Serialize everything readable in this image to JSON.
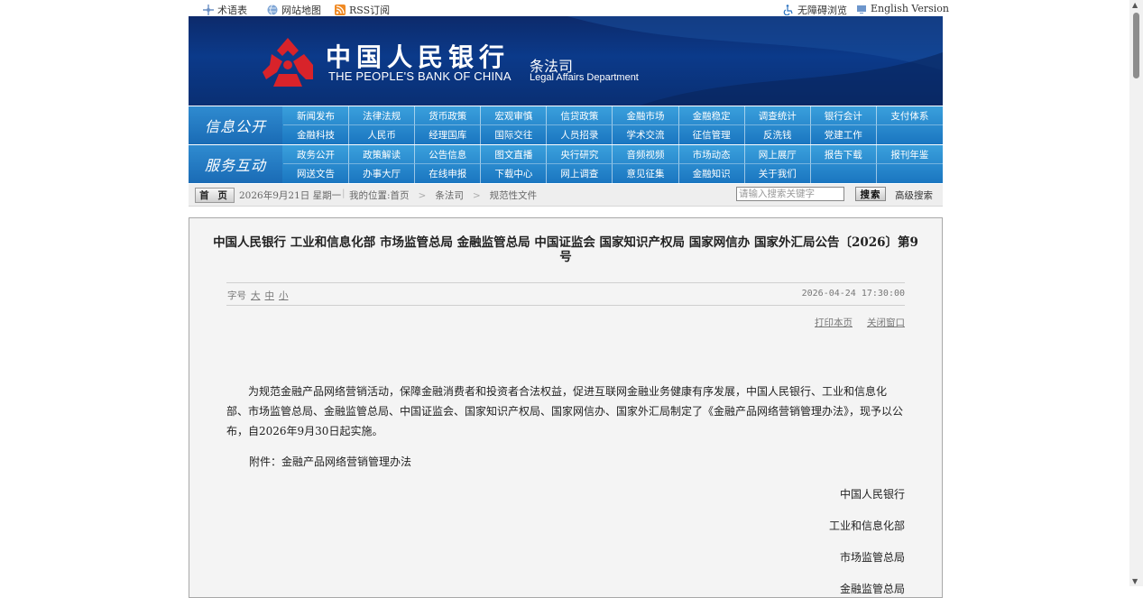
{
  "topbar": {
    "glossary": "术语表",
    "sitemap": "网站地图",
    "rss": "RSS订阅",
    "accessibility": "无障碍浏览",
    "english": "English Version"
  },
  "banner": {
    "cn_name": "中国人民银行",
    "en_name": "THE PEOPLE'S BANK OF CHINA",
    "dept_cn": "条法司",
    "dept_en": "Legal Affairs Department"
  },
  "nav1": {
    "label": "信息公开",
    "items": [
      "新闻发布",
      "法律法规",
      "货币政策",
      "宏观审慎",
      "信贷政策",
      "金融市场",
      "金融稳定",
      "调查统计",
      "银行会计",
      "支付体系",
      "金融科技",
      "人民币",
      "经理国库",
      "国际交往",
      "人员招录",
      "学术交流",
      "征信管理",
      "反洗钱",
      "党建工作",
      ""
    ]
  },
  "nav2": {
    "label": "服务互动",
    "items": [
      "政务公开",
      "政策解读",
      "公告信息",
      "图文直播",
      "央行研究",
      "音频视频",
      "市场动态",
      "网上展厅",
      "报告下载",
      "报刊年鉴",
      "网送文告",
      "办事大厅",
      "在线申报",
      "下载中心",
      "网上调查",
      "意见征集",
      "金融知识",
      "关于我们",
      "",
      ""
    ]
  },
  "crumb": {
    "home": "首 页",
    "date": "2026年9月21日 星期一",
    "location_label": "我的位置:首页",
    "level1": "条法司",
    "level2": "规范性文件",
    "search_placeholder": "请输入搜索关键字",
    "search_button": "搜索",
    "advanced": "高级搜索"
  },
  "article": {
    "title_line1": "中国人民银行 工业和信息化部 市场监管总局 金融监管总局 中国证监会 国家知识产权局 国家网信办 国家外汇局公告〔2026〕第9",
    "title_line2": "号",
    "font_label": "字号",
    "font_large": "大",
    "font_medium": "中",
    "font_small": "小",
    "time": "2026-04-24 17:30:00",
    "print": "打印本页",
    "close": "关闭窗口",
    "paragraph": "为规范金融产品网络营销活动，保障金融消费者和投资者合法权益，促进互联网金融业务健康有序发展，中国人民银行、工业和信息化部、市场监管总局、金融监管总局、中国证监会、国家知识产权局、国家网信办、国家外汇局制定了《金融产品网络营销管理办法》，现予以公布，自2026年9月30日起实施。",
    "attachment": "附件：金融产品网络营销管理办法",
    "signatories": [
      "中国人民银行",
      "工业和信息化部",
      "市场监管总局",
      "金融监管总局"
    ]
  }
}
